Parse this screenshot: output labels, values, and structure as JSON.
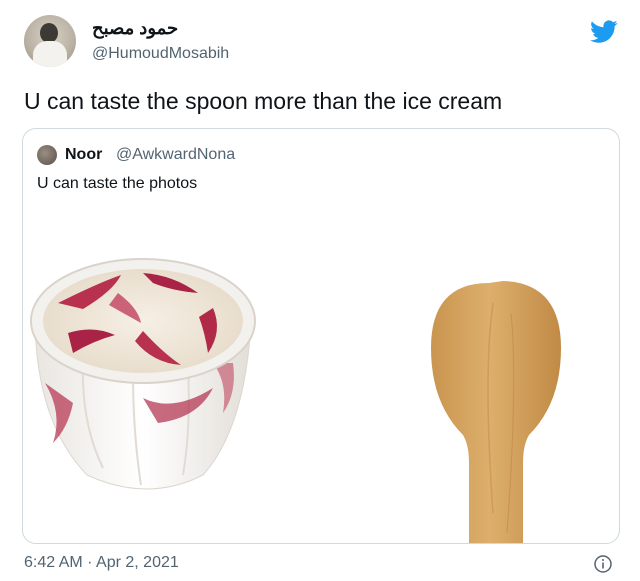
{
  "tweet": {
    "display_name": "حمود مصبح",
    "handle": "@HumoudMosabih",
    "text": "U can taste the spoon more than the ice cream",
    "timestamp": "6:42 AM · Apr 2, 2021",
    "icons": {
      "brand": "twitter-bird-icon",
      "info": "info-icon"
    },
    "colors": {
      "brand": "#1d9bf0",
      "secondary_text": "#536471"
    }
  },
  "quoted_tweet": {
    "display_name": "Noor",
    "handle": "@AwkwardNona",
    "text": "U can taste the photos"
  }
}
